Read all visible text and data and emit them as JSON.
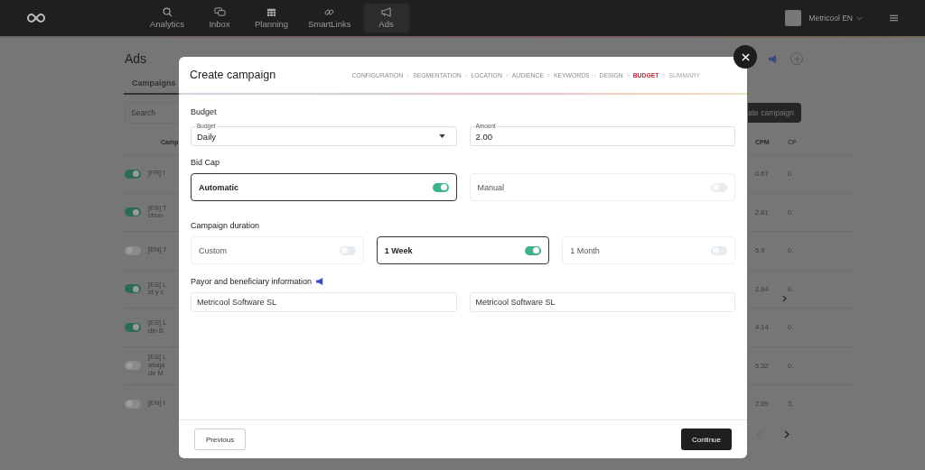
{
  "nav": {
    "items": [
      {
        "label": "Analytics",
        "selected": false
      },
      {
        "label": "Inbox",
        "selected": false
      },
      {
        "label": "Planning",
        "selected": false
      },
      {
        "label": "SmartLinks",
        "selected": false
      },
      {
        "label": "Ads",
        "selected": true
      }
    ],
    "account": "Metricool EN"
  },
  "page": {
    "title": "Ads",
    "tabs": [
      {
        "label": "Campaigns",
        "selected": true
      }
    ],
    "search": {
      "placeholder": "Search"
    },
    "create_button": "ate campaign",
    "table": {
      "columns": [
        "Camp",
        "CPM",
        "CP"
      ],
      "rows": [
        {
          "on": true,
          "name": "[FR] I",
          "cpm": "0.67",
          "column_3": "0"
        },
        {
          "on": true,
          "name": "[ES] T choo",
          "cpm": "2.81",
          "column_3": "0."
        },
        {
          "on": false,
          "name": "[EN] T",
          "cpm": "5.9",
          "column_3": "0."
        },
        {
          "on": true,
          "name": "[ES] L st y c",
          "cpm": "2.84",
          "column_3": "0."
        },
        {
          "on": true,
          "name": "[ES] L dln B",
          "cpm": "4.14",
          "column_3": "0."
        },
        {
          "on": false,
          "name": "[ES] L abaja de M",
          "cpm": "5.32",
          "column_3": "0."
        },
        {
          "on": false,
          "name": "[EN] I",
          "cpm": "2.09",
          "column_3": "3."
        }
      ]
    }
  },
  "modal": {
    "title": "Create campaign",
    "steps": [
      {
        "label": "CONFIGURATION",
        "selected": false,
        "disabled": false
      },
      {
        "label": "SEGMENTATION",
        "selected": false,
        "disabled": false
      },
      {
        "label": "LOCATION",
        "selected": false,
        "disabled": false
      },
      {
        "label": "AUDIENCE",
        "selected": false,
        "disabled": false
      },
      {
        "label": "KEYWORDS",
        "selected": false,
        "disabled": false
      },
      {
        "label": "DESIGN",
        "selected": false,
        "disabled": false
      },
      {
        "label": "BUDGET",
        "selected": true,
        "disabled": false
      },
      {
        "label": "SUMMARY",
        "selected": false,
        "disabled": true
      }
    ],
    "budget": {
      "heading": "Budget",
      "type_field": {
        "label": "Budget",
        "value": "Daily"
      },
      "amount_field": {
        "label": "Amount",
        "value": "2.00"
      }
    },
    "bid_cap": {
      "heading": "Bid Cap",
      "options": [
        {
          "label": "Automatic",
          "selected": true
        },
        {
          "label": "Manual",
          "selected": false
        }
      ]
    },
    "duration": {
      "heading": "Campaign duration",
      "options": [
        {
          "label": "Custom",
          "selected": false
        },
        {
          "label": "1 Week",
          "selected": true
        },
        {
          "label": "1 Month",
          "selected": false
        }
      ]
    },
    "payor": {
      "heading": "Payor and beneficiary information",
      "fields": [
        {
          "value": "Metricool Software SL"
        },
        {
          "value": "Metricool Software SL"
        }
      ]
    },
    "buttons": {
      "previous": "Previous",
      "continue": "Continue"
    }
  }
}
